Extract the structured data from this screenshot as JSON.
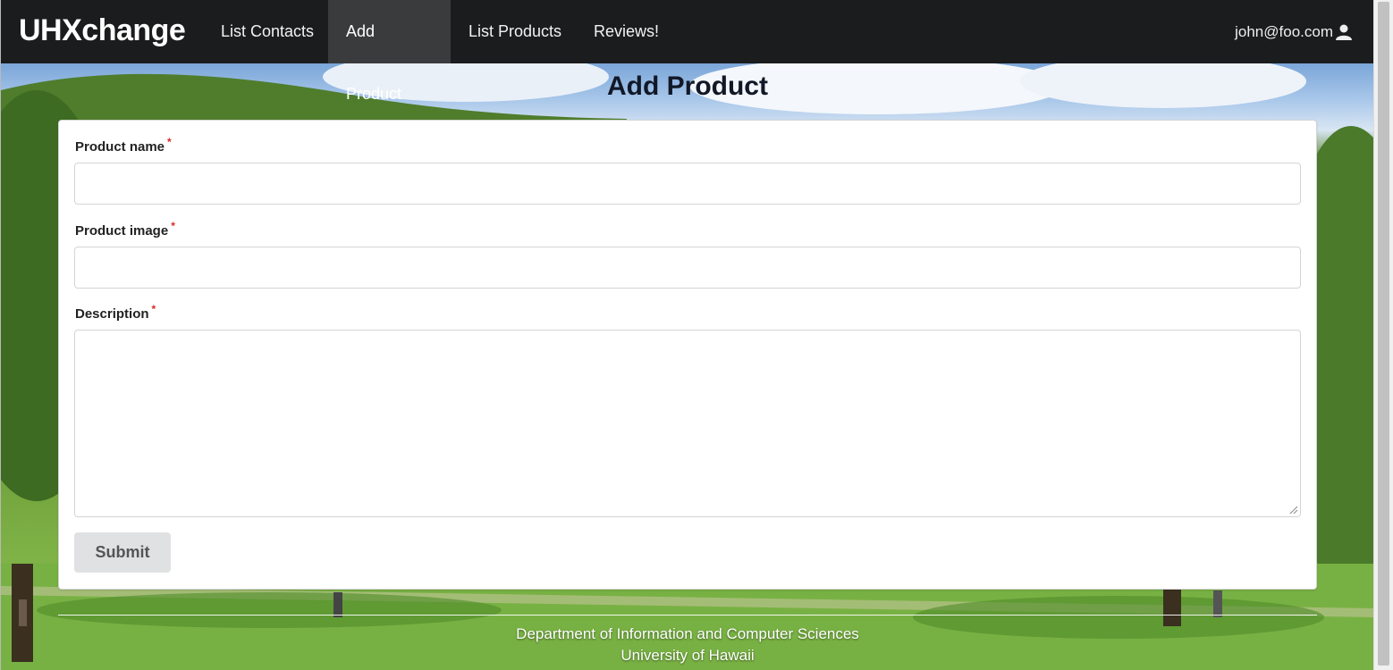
{
  "navbar": {
    "brand": "UHXchange",
    "items": [
      {
        "label": "List Contacts",
        "active": false
      },
      {
        "label": "Add Product",
        "active": true
      },
      {
        "label": "List Products",
        "active": false
      },
      {
        "label": "Reviews!",
        "active": false
      }
    ],
    "user": "john@foo.com",
    "user_icon": "user-icon"
  },
  "page": {
    "title": "Add Product"
  },
  "form": {
    "fields": [
      {
        "label": "Product name",
        "required_mark": "*",
        "value": ""
      },
      {
        "label": "Product image",
        "required_mark": "*",
        "value": ""
      },
      {
        "label": "Description",
        "required_mark": "*",
        "value": ""
      }
    ],
    "submit_label": "Submit"
  },
  "footer": {
    "line1": "Department of Information and Computer Sciences",
    "line2": "University of Hawaii"
  },
  "colors": {
    "navbar_bg": "#1b1c1d",
    "active_item_bg": "#3a3b3c",
    "required": "#db2828",
    "submit_bg": "#e0e1e2"
  }
}
